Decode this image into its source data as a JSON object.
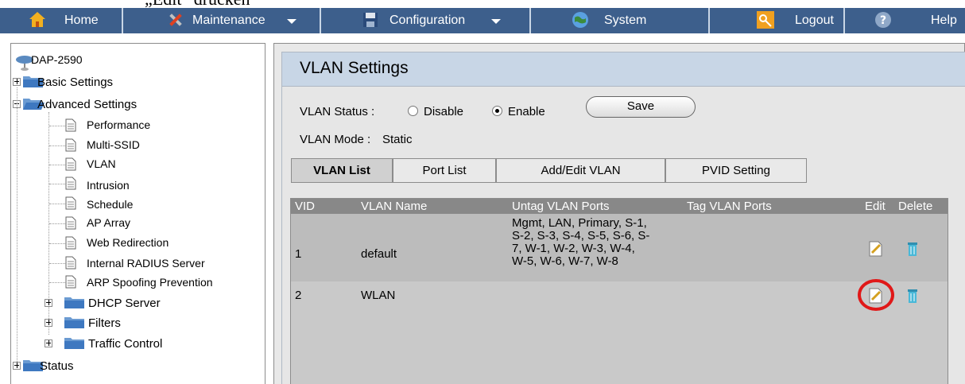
{
  "caption": "„Edit“ drücken",
  "topnav": {
    "items": [
      {
        "label": "Home",
        "icon": "home-icon"
      },
      {
        "label": "Maintenance",
        "icon": "tools-icon",
        "dropdown": true
      },
      {
        "label": "Configuration",
        "icon": "floppy-icon",
        "dropdown": true
      },
      {
        "label": "System",
        "icon": "globe-icon"
      },
      {
        "label": "Logout",
        "icon": "key-icon"
      },
      {
        "label": "Help",
        "icon": "help-icon"
      }
    ]
  },
  "tree": {
    "root": "DAP-2590",
    "basic": "Basic Settings",
    "advanced": "Advanced Settings",
    "advanced_items": [
      "Performance",
      "Multi-SSID",
      "VLAN",
      "Intrusion",
      "Schedule",
      "AP Array",
      "Web Redirection",
      "Internal RADIUS Server",
      "ARP Spoofing Prevention"
    ],
    "sub_folders": [
      "DHCP Server",
      "Filters",
      "Traffic Control"
    ],
    "status": "Status"
  },
  "page": {
    "title": "VLAN Settings",
    "vlan_status_label": "VLAN Status :",
    "disable_label": "Disable",
    "enable_label": "Enable",
    "status_value": "Enable",
    "save_label": "Save",
    "vlan_mode_label": "VLAN Mode :",
    "vlan_mode_value": "Static"
  },
  "tabs": [
    "VLAN List",
    "Port List",
    "Add/Edit VLAN",
    "PVID Setting"
  ],
  "active_tab": "VLAN List",
  "table": {
    "headers": [
      "VID",
      "VLAN Name",
      "Untag VLAN Ports",
      "Tag VLAN Ports",
      "Edit",
      "Delete"
    ],
    "rows": [
      {
        "vid": "1",
        "name": "default",
        "untag_lines": [
          "Mgmt, LAN, Primary, S-1,",
          "S-2, S-3, S-4, S-5, S-6, S-",
          "7, W-1, W-2, W-3, W-4,",
          "W-5, W-6, W-7, W-8"
        ],
        "tag": ""
      },
      {
        "vid": "2",
        "name": "WLAN",
        "untag_lines": [],
        "tag": ""
      }
    ]
  },
  "colors": {
    "nav_bg": "#3d5f8c",
    "header_bg": "#c8d6e6",
    "table_header": "#888888",
    "highlight": "#e01818"
  }
}
